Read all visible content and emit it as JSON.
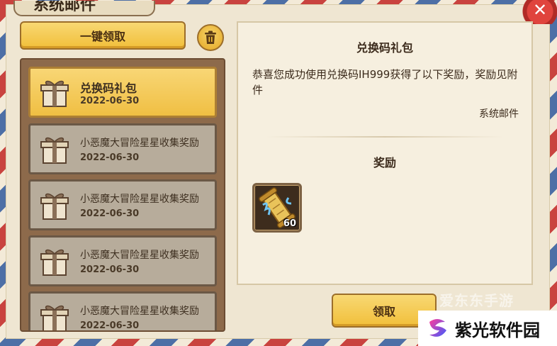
{
  "window": {
    "title": "系统邮件",
    "close_icon": "close-icon"
  },
  "toolbar": {
    "claim_all_label": "一键领取",
    "delete_icon": "trash-icon"
  },
  "mail_list": [
    {
      "title": "兑换码礼包",
      "date": "2022-06-30",
      "icon": "gift-box-icon",
      "selected": true
    },
    {
      "title": "小恶魔大冒险星星收集奖励",
      "date": "2022-06-30",
      "icon": "gift-box-icon",
      "selected": false
    },
    {
      "title": "小恶魔大冒险星星收集奖励",
      "date": "2022-06-30",
      "icon": "gift-box-icon",
      "selected": false
    },
    {
      "title": "小恶魔大冒险星星收集奖励",
      "date": "2022-06-30",
      "icon": "gift-box-icon",
      "selected": false
    },
    {
      "title": "小恶魔大冒险星星收集奖励",
      "date": "2022-06-30",
      "icon": "gift-box-icon",
      "selected": false
    }
  ],
  "detail": {
    "title": "兑换码礼包",
    "body": "恭喜您成功使用兑换码IH999获得了以下奖励，奖励见附件",
    "sender": "系统邮件",
    "rewards_heading": "奖励",
    "rewards": [
      {
        "icon": "scroll-item-icon",
        "count": "60"
      }
    ],
    "claim_label": "领取"
  },
  "watermarks": {
    "small_text": "爱东东手游",
    "site_name": "紫光软件园"
  },
  "colors": {
    "accent": "#f1bf3a",
    "selected_item": "#f0bf43",
    "unselected_item": "#b7ac9b",
    "close": "#e0443d"
  }
}
